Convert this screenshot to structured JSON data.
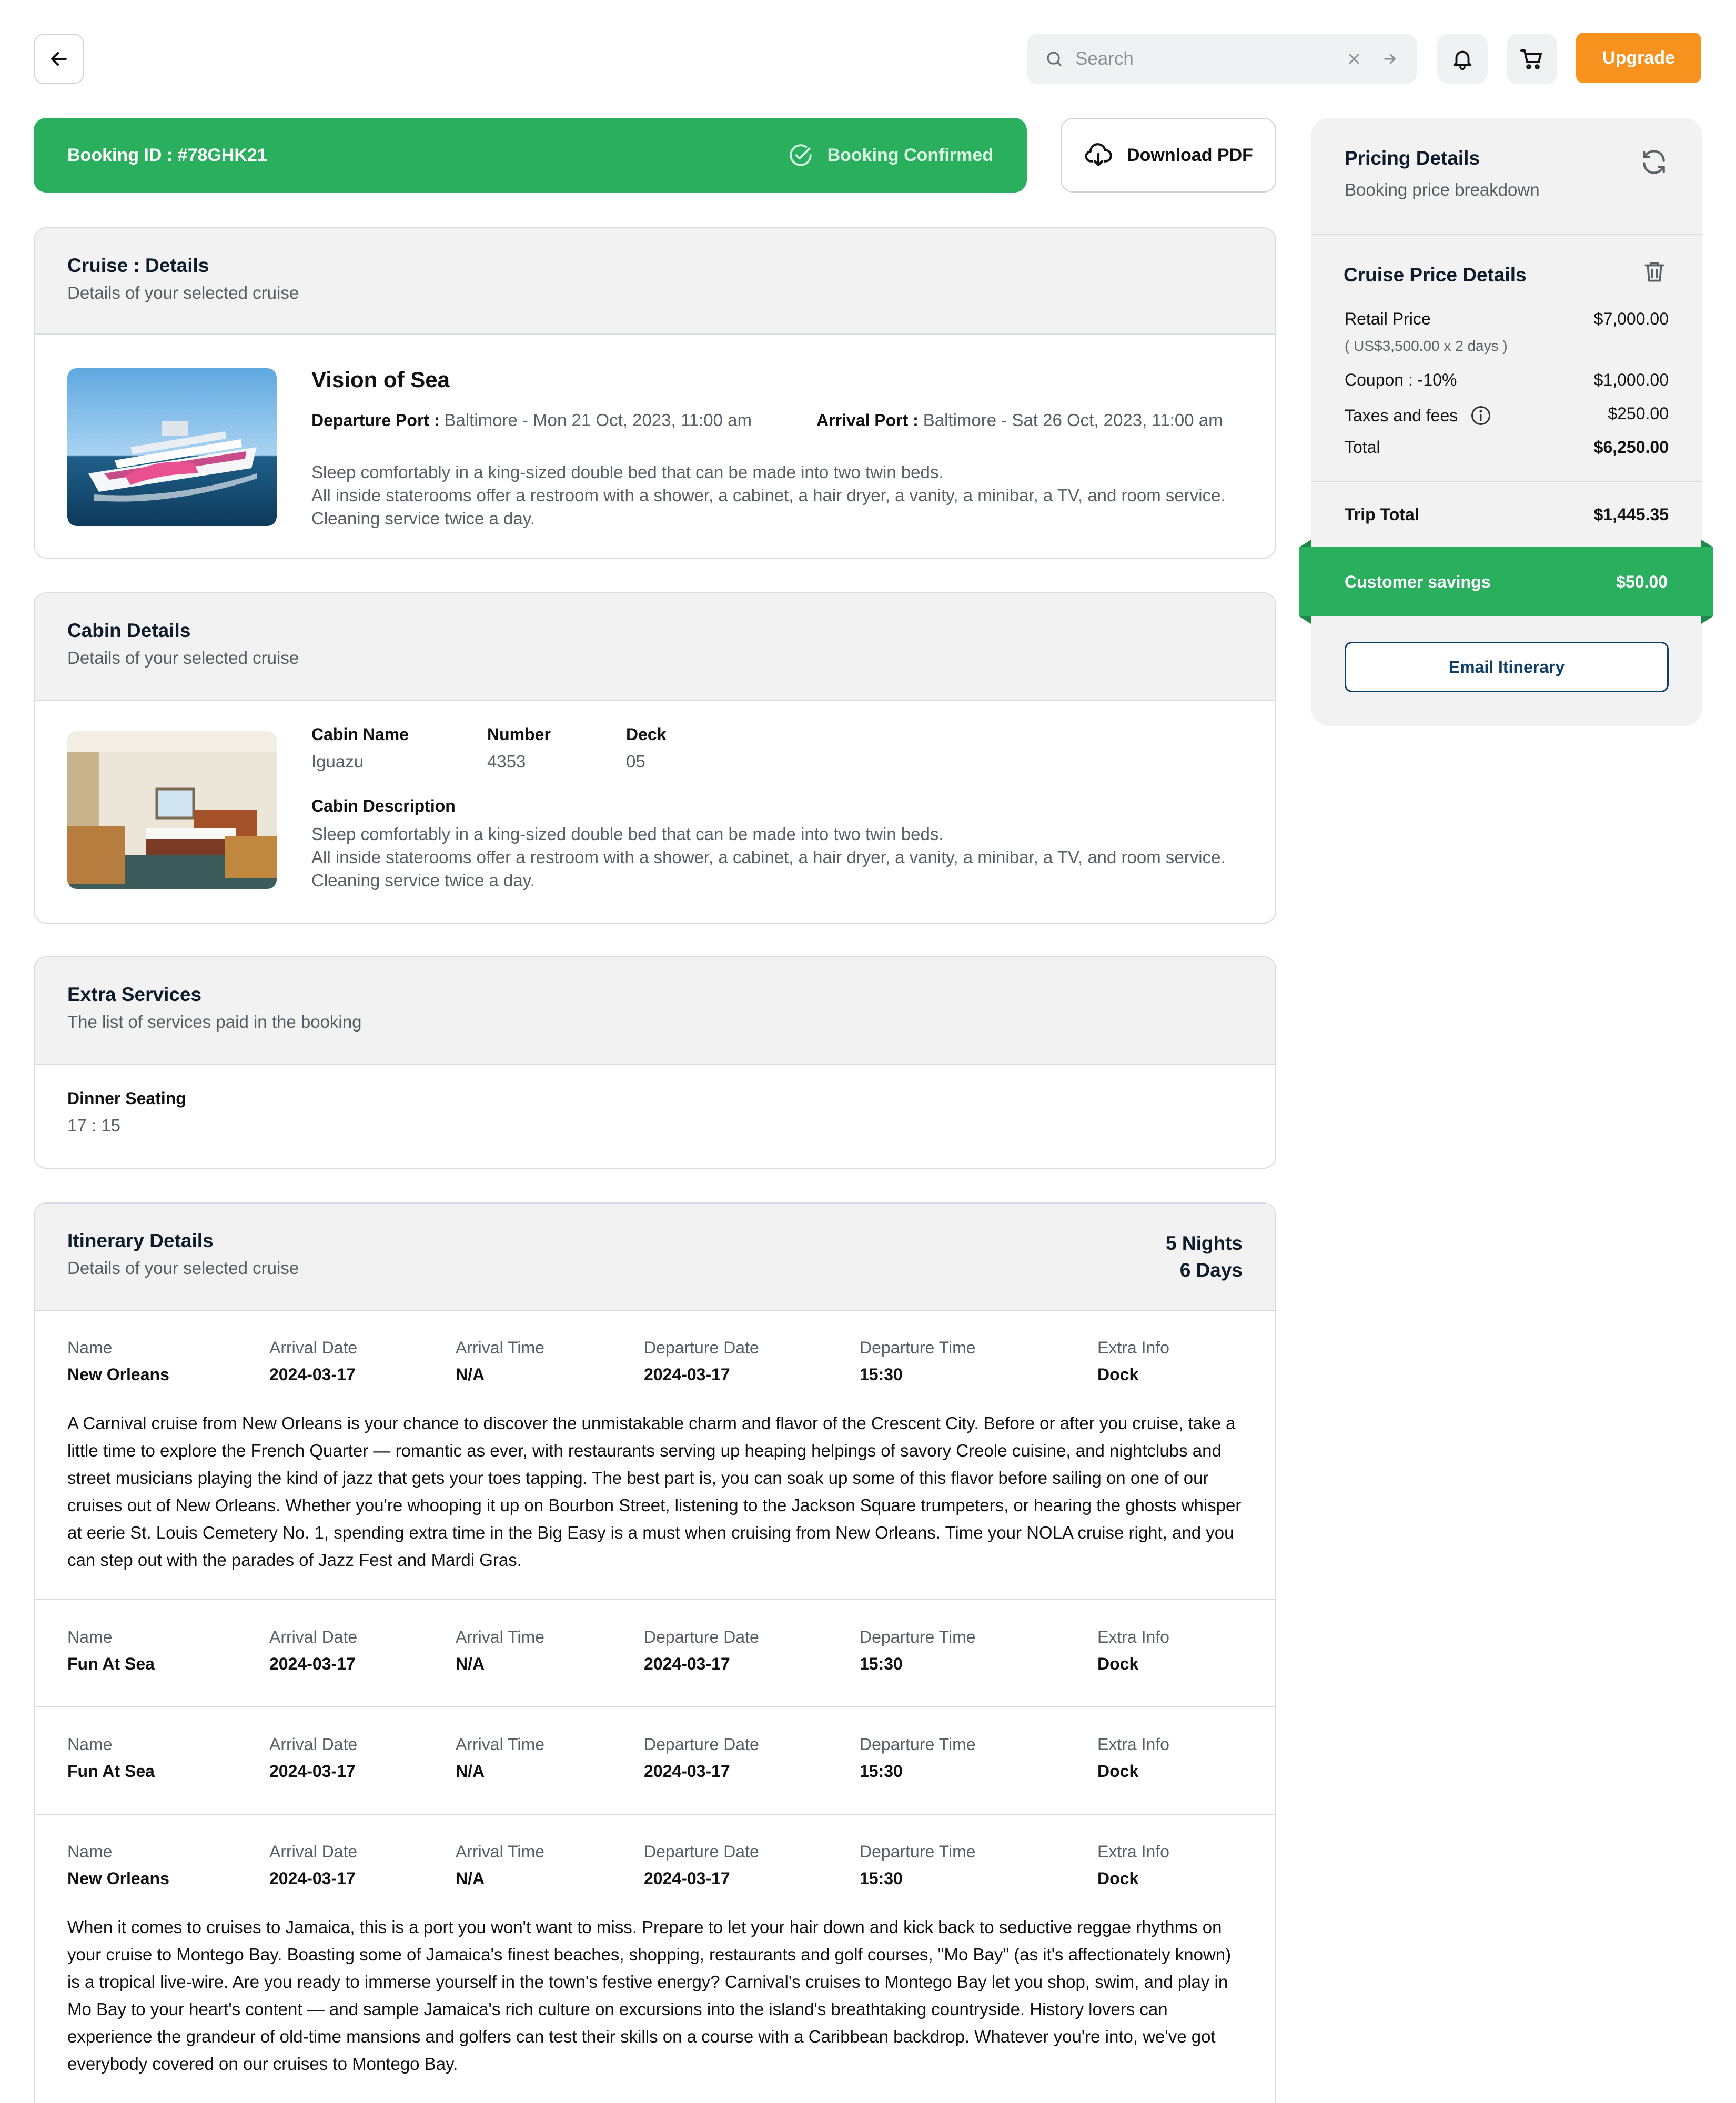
{
  "search": {
    "placeholder": "Search"
  },
  "header": {
    "upgrade_label": "Upgrade"
  },
  "banner": {
    "booking_id": "Booking ID : #78GHK21",
    "status": "Booking Confirmed"
  },
  "download": {
    "label": "Download PDF"
  },
  "cruise": {
    "title": "Cruise : Details",
    "subtitle": "Details of your selected cruise",
    "ship_name": "Vision of Sea",
    "departure_label": "Departure Port :",
    "departure_value": "Baltimore - Mon 21 Oct, 2023, 11:00 am",
    "arrival_label": "Arrival Port :",
    "arrival_value": "Baltimore - Sat 26 Oct, 2023, 11:00 am",
    "desc_line1": "Sleep comfortably in a king-sized double bed that can be made into two twin beds.",
    "desc_line2": "All inside staterooms offer a restroom with a shower, a cabinet, a hair dryer, a vanity, a minibar, a TV, and room service. Cleaning service twice a day."
  },
  "cabin": {
    "title": "Cabin Details",
    "subtitle": "Details of your selected cruise",
    "name_label": "Cabin Name",
    "name_value": "Iguazu",
    "number_label": "Number",
    "number_value": "4353",
    "deck_label": "Deck",
    "deck_value": "05",
    "desc_label": "Cabin Description",
    "desc_line1": "Sleep comfortably in a king-sized double bed that can be made into two twin beds.",
    "desc_line2": "All inside staterooms offer a restroom with a shower, a cabinet, a hair dryer, a vanity, a minibar, a TV, and room service. Cleaning service twice a day."
  },
  "extras": {
    "title": "Extra Services",
    "subtitle": "The list of services paid in the booking",
    "service_label": "Dinner Seating",
    "service_value": "17 : 15"
  },
  "itinerary": {
    "title": "Itinerary Details",
    "subtitle": "Details of your selected cruise",
    "nights": "5 Nights",
    "days": "6 Days",
    "headers": [
      "Name",
      "Arrival Date",
      "Arrival Time",
      "Departure Date",
      "Departure Time",
      "Extra Info"
    ],
    "rows": [
      {
        "name": "New Orleans",
        "arrival_date": "2024-03-17",
        "arrival_time": "N/A",
        "departure_date": "2024-03-17",
        "departure_time": "15:30",
        "extra": "Dock",
        "text": "A Carnival cruise from New Orleans is your chance to discover the unmistakable charm and flavor of the Crescent City. Before or after you cruise, take a little time to explore the French Quarter — romantic as ever, with restaurants serving up heaping helpings of savory Creole cuisine, and nightclubs and street musicians playing the kind of jazz that gets your toes tapping. The best part is, you can soak up some of this flavor before sailing on one of our cruises out of New Orleans.  Whether you're whooping it up on Bourbon Street, listening to the Jackson Square trumpeters, or hearing the ghosts whisper at eerie St. Louis Cemetery No. 1, spending extra time in the Big Easy is a must when cruising from New Orleans. Time your NOLA cruise right, and you can step out with the parades of Jazz Fest and Mardi Gras."
      },
      {
        "name": "Fun At Sea",
        "arrival_date": "2024-03-17",
        "arrival_time": "N/A",
        "departure_date": "2024-03-17",
        "departure_time": "15:30",
        "extra": "Dock"
      },
      {
        "name": "Fun At Sea",
        "arrival_date": "2024-03-17",
        "arrival_time": "N/A",
        "departure_date": "2024-03-17",
        "departure_time": "15:30",
        "extra": "Dock"
      },
      {
        "name": "New Orleans",
        "arrival_date": "2024-03-17",
        "arrival_time": "N/A",
        "departure_date": "2024-03-17",
        "departure_time": "15:30",
        "extra": "Dock",
        "text": "When it comes to cruises to Jamaica, this is a port you won't want to miss. Prepare to let your hair down and kick back to seductive reggae rhythms on your cruise to Montego Bay. Boasting some of Jamaica's finest beaches, shopping, restaurants and golf courses, \"Mo Bay\" (as it's affectionately known) is a tropical live-wire. Are you ready to immerse yourself in the town's festive energy? Carnival's cruises to Montego Bay let you shop, swim, and play in Mo Bay to your heart's content — and sample Jamaica's rich culture on excursions into the island's breathtaking countryside. History lovers can experience the grandeur of old-time mansions and golfers can test their skills on a course with a Caribbean backdrop. Whatever you're into, we've got everybody covered on our cruises to Montego Bay."
      }
    ]
  },
  "pricing": {
    "title": "Pricing Details",
    "subtitle": "Booking price breakdown",
    "section_title": "Cruise Price Details",
    "retail_label": "Retail Price",
    "retail_value": "$7,000.00",
    "retail_note": "( US$3,500.00 x 2 days )",
    "coupon_label": "Coupon : -10%",
    "coupon_value": "$1,000.00",
    "taxes_label": "Taxes and fees",
    "taxes_value": "$250.00",
    "total_label": "Total",
    "total_value": "$6,250.00",
    "trip_total_label": "Trip Total",
    "trip_total_value": "$1,445.35",
    "savings_label": "Customer savings",
    "savings_value": "$50.00",
    "email_label": "Email Itinerary"
  },
  "colors": {
    "green": "#2aaf5f",
    "orange": "#f7921e",
    "navy": "#0f3d66"
  }
}
